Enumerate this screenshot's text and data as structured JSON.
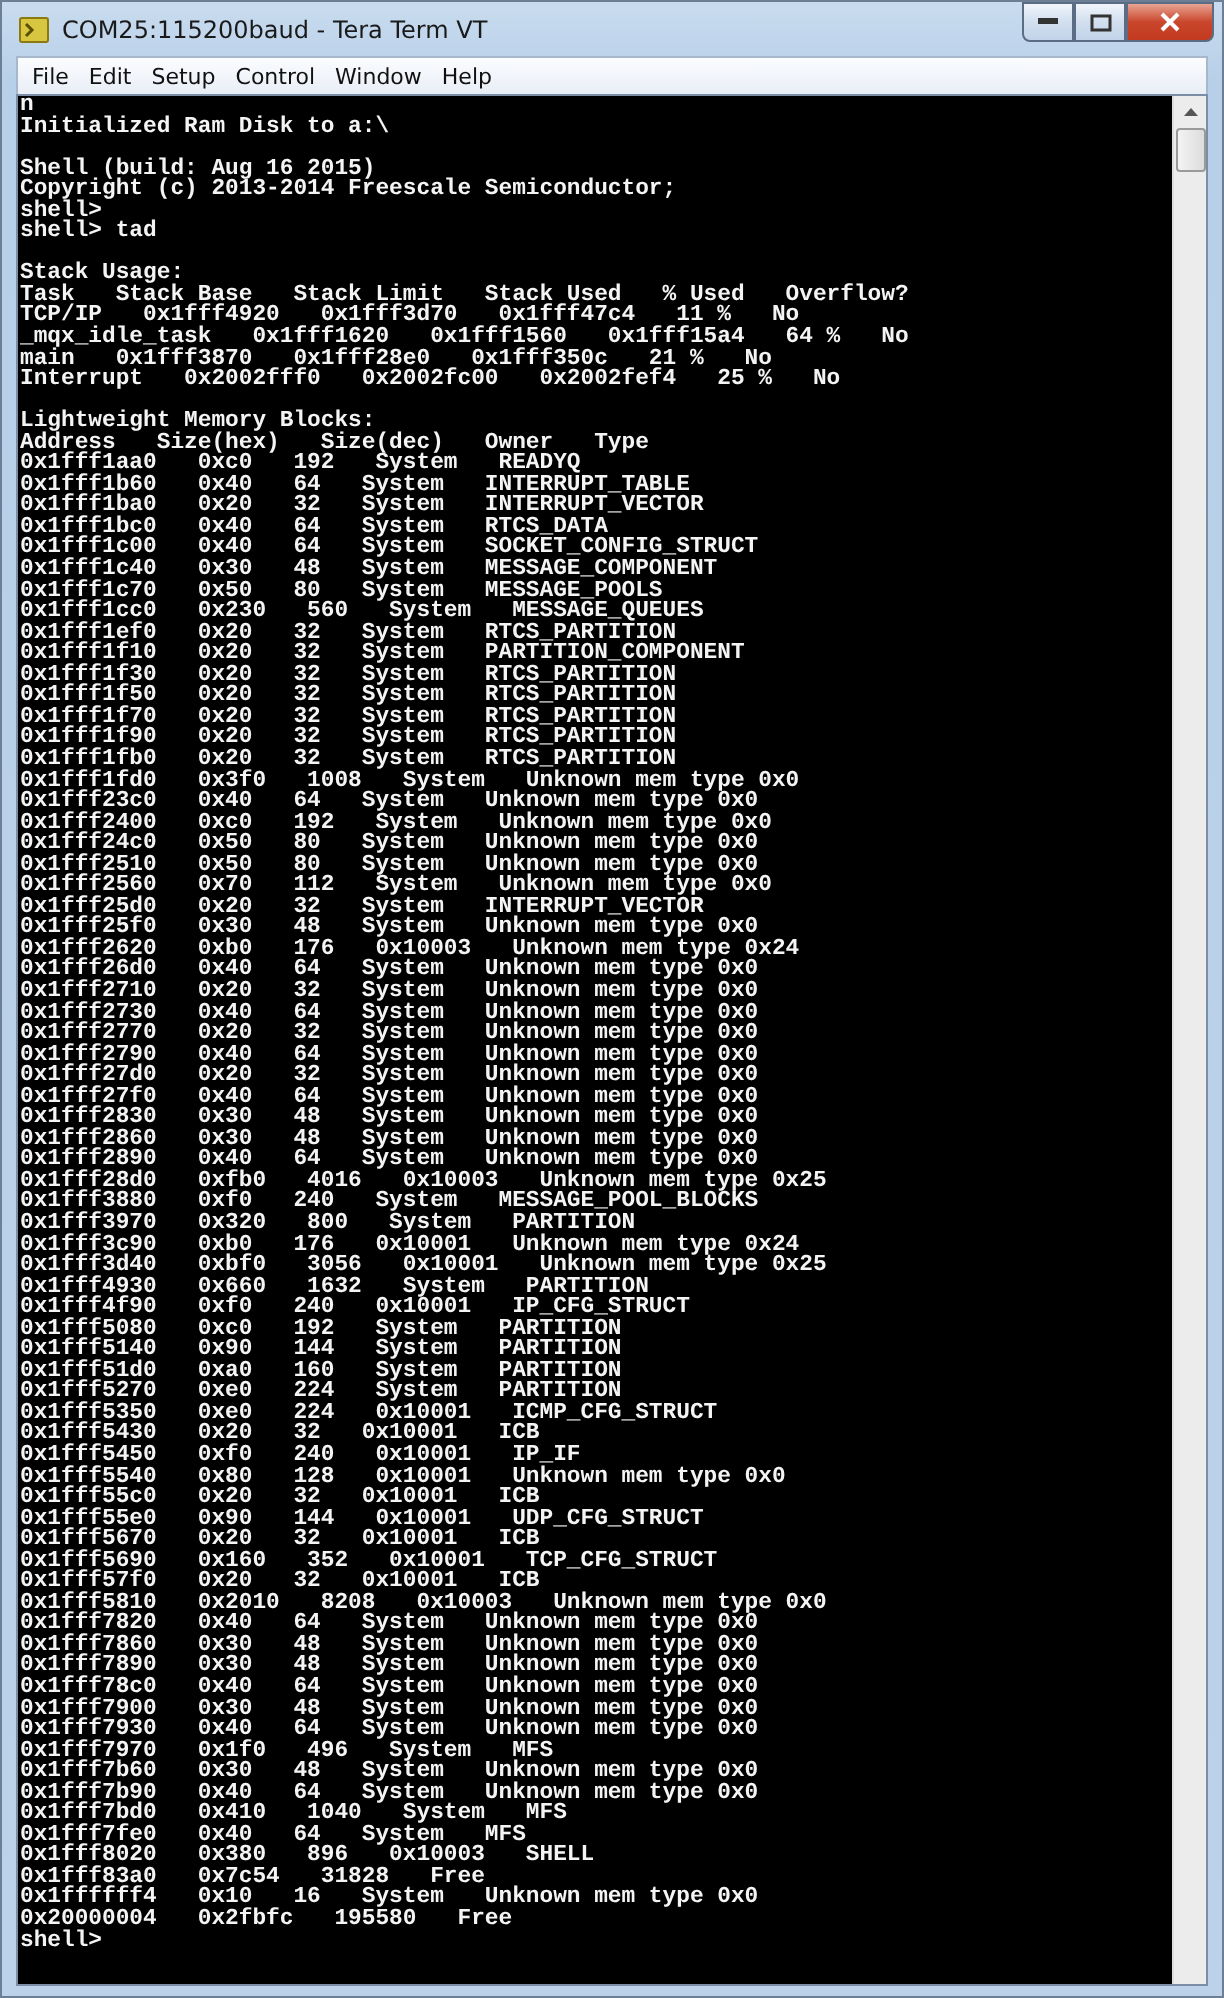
{
  "window": {
    "title": "COM25:115200baud - Tera Term VT"
  },
  "menu": [
    "File",
    "Edit",
    "Setup",
    "Control",
    "Window",
    "Help"
  ],
  "terminal": {
    "blocks": [
      [
        "n",
        "Initialized Ram Disk to a:\\"
      ],
      [
        "Shell (build: Aug 16 2015)",
        "Copyright (c) 2013-2014 Freescale Semiconductor;",
        "shell>",
        "shell> tad"
      ],
      [
        "Stack Usage:",
        "Task   Stack Base   Stack Limit   Stack Used   % Used   Overflow?",
        "TCP/IP   0x1fff4920   0x1fff3d70   0x1fff47c4   11 %   No",
        "_mqx_idle_task   0x1fff1620   0x1fff1560   0x1fff15a4   64 %   No",
        "main   0x1fff3870   0x1fff28e0   0x1fff350c   21 %   No",
        "Interrupt   0x2002fff0   0x2002fc00   0x2002fef4   25 %   No"
      ],
      [
        "Lightweight Memory Blocks:",
        "Address   Size(hex)   Size(dec)   Owner   Type",
        "0x1fff1aa0   0xc0   192   System   READYQ",
        "0x1fff1b60   0x40   64   System   INTERRUPT_TABLE",
        "0x1fff1ba0   0x20   32   System   INTERRUPT_VECTOR",
        "0x1fff1bc0   0x40   64   System   RTCS_DATA",
        "0x1fff1c00   0x40   64   System   SOCKET_CONFIG_STRUCT",
        "0x1fff1c40   0x30   48   System   MESSAGE_COMPONENT",
        "0x1fff1c70   0x50   80   System   MESSAGE_POOLS",
        "0x1fff1cc0   0x230   560   System   MESSAGE_QUEUES",
        "0x1fff1ef0   0x20   32   System   RTCS_PARTITION",
        "0x1fff1f10   0x20   32   System   PARTITION_COMPONENT",
        "0x1fff1f30   0x20   32   System   RTCS_PARTITION",
        "0x1fff1f50   0x20   32   System   RTCS_PARTITION",
        "0x1fff1f70   0x20   32   System   RTCS_PARTITION",
        "0x1fff1f90   0x20   32   System   RTCS_PARTITION",
        "0x1fff1fb0   0x20   32   System   RTCS_PARTITION",
        "0x1fff1fd0   0x3f0   1008   System   Unknown mem type 0x0",
        "0x1fff23c0   0x40   64   System   Unknown mem type 0x0",
        "0x1fff2400   0xc0   192   System   Unknown mem type 0x0",
        "0x1fff24c0   0x50   80   System   Unknown mem type 0x0",
        "0x1fff2510   0x50   80   System   Unknown mem type 0x0",
        "0x1fff2560   0x70   112   System   Unknown mem type 0x0",
        "0x1fff25d0   0x20   32   System   INTERRUPT_VECTOR",
        "0x1fff25f0   0x30   48   System   Unknown mem type 0x0",
        "0x1fff2620   0xb0   176   0x10003   Unknown mem type 0x24",
        "0x1fff26d0   0x40   64   System   Unknown mem type 0x0",
        "0x1fff2710   0x20   32   System   Unknown mem type 0x0",
        "0x1fff2730   0x40   64   System   Unknown mem type 0x0",
        "0x1fff2770   0x20   32   System   Unknown mem type 0x0",
        "0x1fff2790   0x40   64   System   Unknown mem type 0x0",
        "0x1fff27d0   0x20   32   System   Unknown mem type 0x0",
        "0x1fff27f0   0x40   64   System   Unknown mem type 0x0",
        "0x1fff2830   0x30   48   System   Unknown mem type 0x0",
        "0x1fff2860   0x30   48   System   Unknown mem type 0x0",
        "0x1fff2890   0x40   64   System   Unknown mem type 0x0",
        "0x1fff28d0   0xfb0   4016   0x10003   Unknown mem type 0x25",
        "0x1fff3880   0xf0   240   System   MESSAGE_POOL_BLOCKS",
        "0x1fff3970   0x320   800   System   PARTITION",
        "0x1fff3c90   0xb0   176   0x10001   Unknown mem type 0x24",
        "0x1fff3d40   0xbf0   3056   0x10001   Unknown mem type 0x25",
        "0x1fff4930   0x660   1632   System   PARTITION",
        "0x1fff4f90   0xf0   240   0x10001   IP_CFG_STRUCT",
        "0x1fff5080   0xc0   192   System   PARTITION",
        "0x1fff5140   0x90   144   System   PARTITION",
        "0x1fff51d0   0xa0   160   System   PARTITION",
        "0x1fff5270   0xe0   224   System   PARTITION",
        "0x1fff5350   0xe0   224   0x10001   ICMP_CFG_STRUCT",
        "0x1fff5430   0x20   32   0x10001   ICB",
        "0x1fff5450   0xf0   240   0x10001   IP_IF",
        "0x1fff5540   0x80   128   0x10001   Unknown mem type 0x0",
        "0x1fff55c0   0x20   32   0x10001   ICB",
        "0x1fff55e0   0x90   144   0x10001   UDP_CFG_STRUCT",
        "0x1fff5670   0x20   32   0x10001   ICB",
        "0x1fff5690   0x160   352   0x10001   TCP_CFG_STRUCT",
        "0x1fff57f0   0x20   32   0x10001   ICB",
        "0x1fff5810   0x2010   8208   0x10003   Unknown mem type 0x0",
        "0x1fff7820   0x40   64   System   Unknown mem type 0x0",
        "0x1fff7860   0x30   48   System   Unknown mem type 0x0",
        "0x1fff7890   0x30   48   System   Unknown mem type 0x0",
        "0x1fff78c0   0x40   64   System   Unknown mem type 0x0",
        "0x1fff7900   0x30   48   System   Unknown mem type 0x0",
        "0x1fff7930   0x40   64   System   Unknown mem type 0x0",
        "0x1fff7970   0x1f0   496   System   MFS",
        "0x1fff7b60   0x30   48   System   Unknown mem type 0x0",
        "0x1fff7b90   0x40   64   System   Unknown mem type 0x0",
        "0x1fff7bd0   0x410   1040   System   MFS",
        "0x1fff7fe0   0x40   64   System   MFS",
        "0x1fff8020   0x380   896   0x10003   SHELL",
        "0x1fff83a0   0x7c54   31828   Free",
        "0x1ffffff4   0x10   16   System   Unknown mem type 0x0",
        "0x20000004   0x2fbfc   195580   Free",
        "shell>"
      ]
    ]
  }
}
